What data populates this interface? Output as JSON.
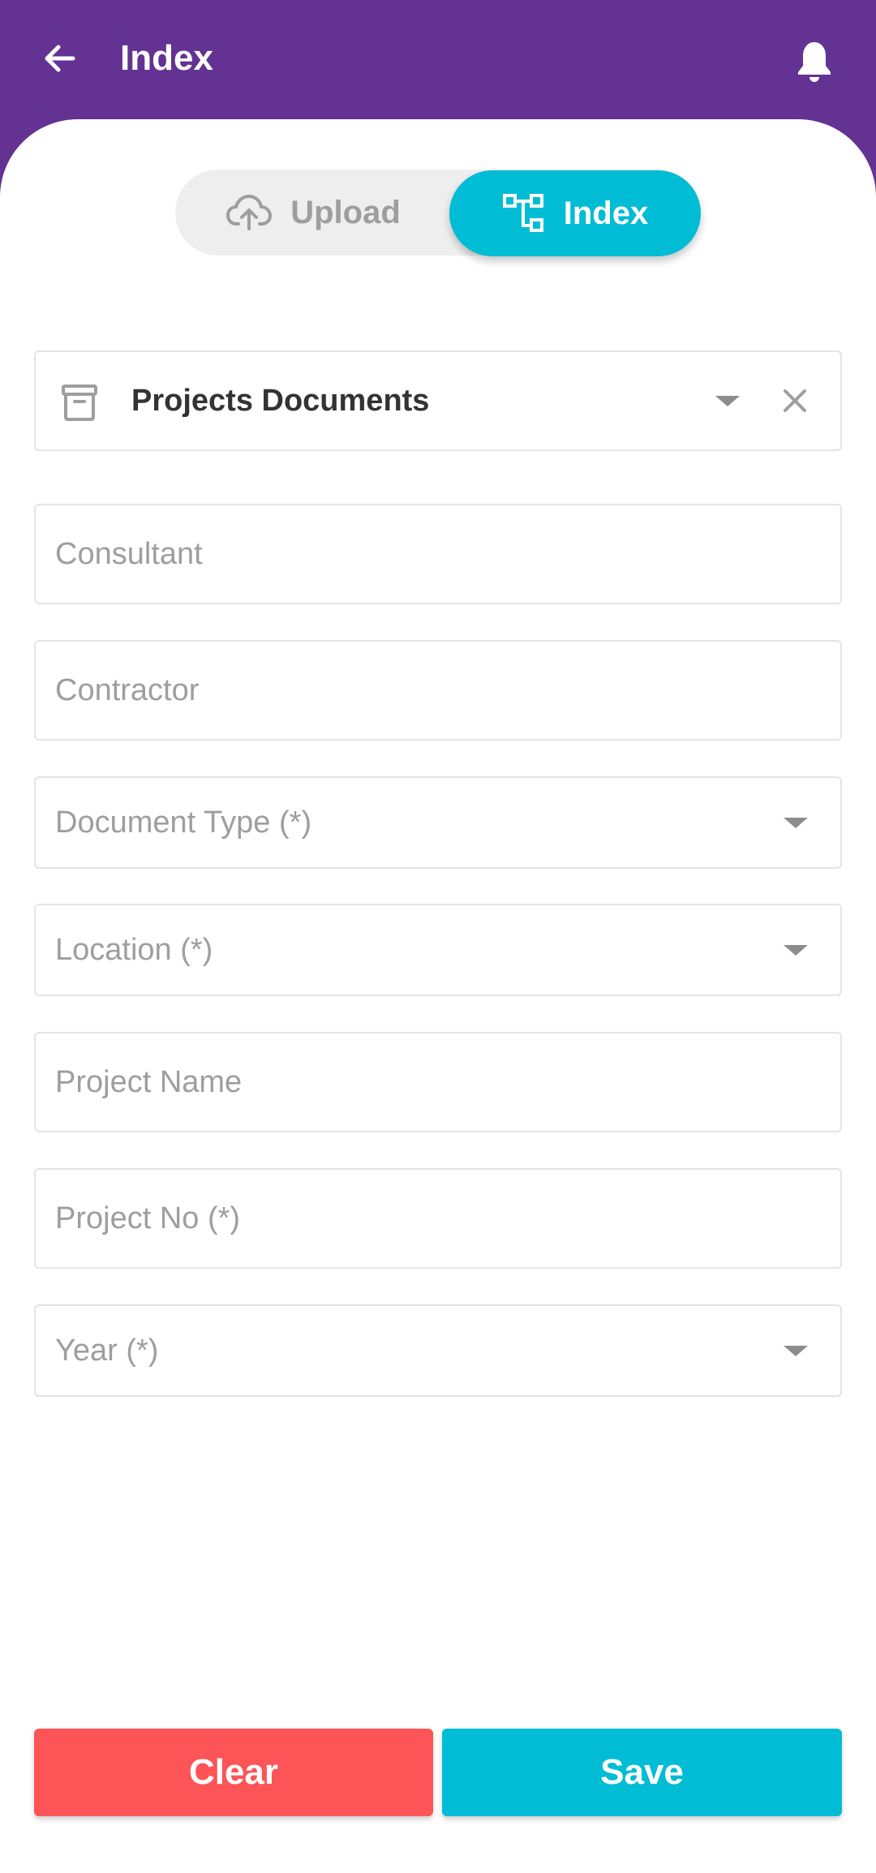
{
  "appbar": {
    "title": "Index"
  },
  "toggle": {
    "upload_label": "Upload",
    "index_label": "Index",
    "selected": "Index"
  },
  "cabinet": {
    "value": "Projects Documents"
  },
  "fields": {
    "consultant_placeholder": "Consultant",
    "contractor_placeholder": "Contractor",
    "document_type_placeholder": "Document Type (*)",
    "location_placeholder": "Location (*)",
    "project_name_placeholder": "Project Name",
    "project_no_placeholder": "Project No (*)",
    "year_placeholder": "Year (*)"
  },
  "actions": {
    "clear_label": "Clear",
    "save_label": "Save"
  },
  "icons": {
    "back": "arrow-left-icon",
    "bell": "bell-icon",
    "upload": "cloud-upload-icon",
    "index": "hierarchy-icon",
    "cabinet": "archive-box-icon",
    "clear": "close-icon",
    "dropdown": "caret-down-icon"
  },
  "colors": {
    "appbar": "#633293",
    "accent": "#00bcd4",
    "danger": "#fd5457",
    "placeholder": "#9e9e9e"
  }
}
